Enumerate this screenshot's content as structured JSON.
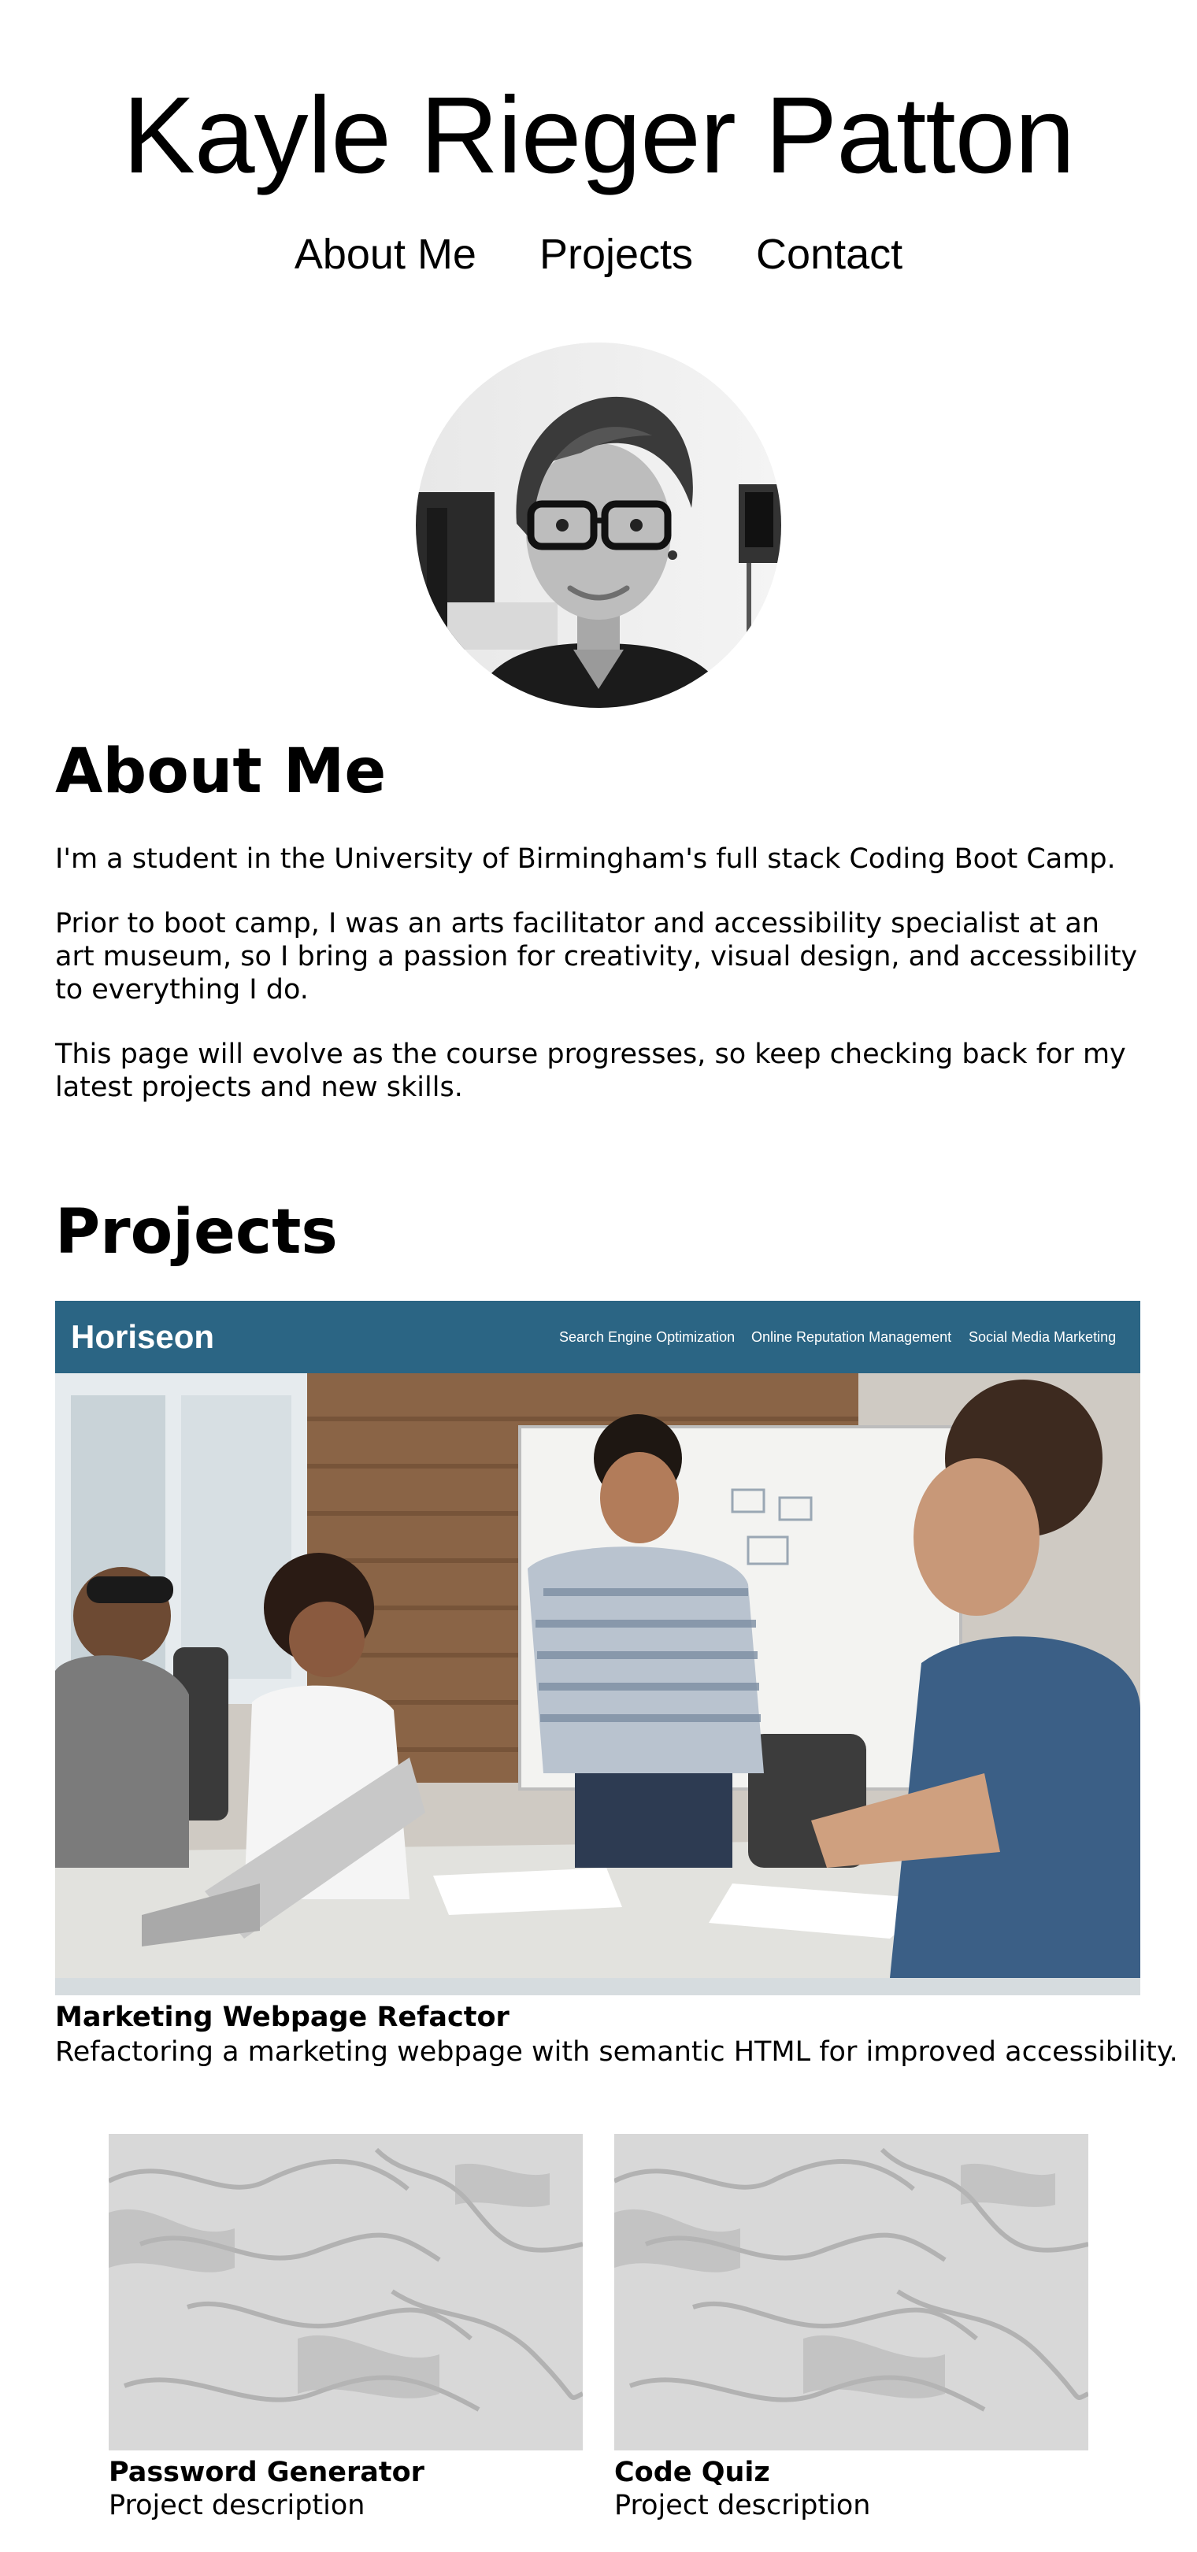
{
  "header": {
    "name": "Kayle Rieger Patton",
    "nav": [
      "About Me",
      "Projects",
      "Contact"
    ]
  },
  "about": {
    "heading": "About Me",
    "paragraphs": [
      "I'm a student in the University of Birmingham's full stack Coding Boot Camp.",
      "Prior to boot camp, I was an arts facilitator and accessibility specialist at an art museum, so I bring a passion for creativity, visual design, and accessibility to everything I do.",
      "This page will evolve as the course progresses, so keep checking back for my latest projects and new skills."
    ]
  },
  "projects": {
    "heading": "Projects",
    "featured": {
      "title": "Marketing Webpage Refactor",
      "description": "Refactoring a marketing webpage with semantic HTML for improved accessibility.",
      "screenshot": {
        "logo": "Horiseon",
        "nav": [
          "Search Engine Optimization",
          "Online Reputation Management",
          "Social Media Marketing"
        ],
        "banner_color": "#2b6584"
      }
    },
    "cards": [
      {
        "title": "Password Generator",
        "description": "Project description"
      },
      {
        "title": "Code Quiz",
        "description": "Project description"
      }
    ]
  }
}
